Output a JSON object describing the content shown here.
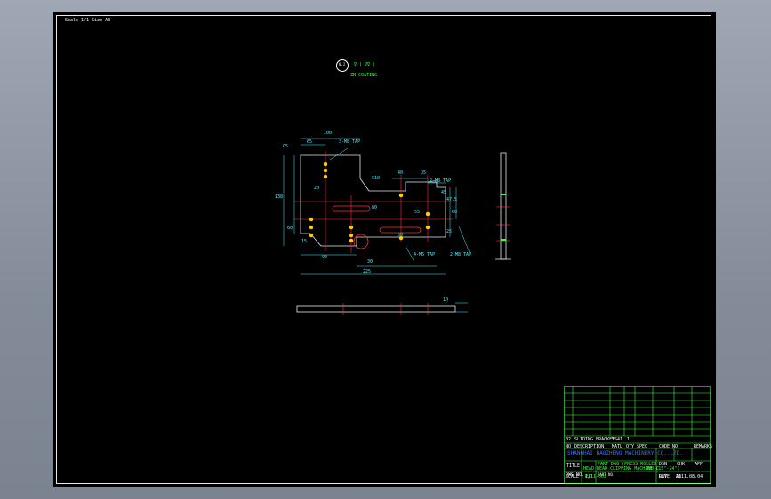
{
  "header": {
    "scale_note": "Scale 1/1  Size A3"
  },
  "surface_note": {
    "roughness": "0.2",
    "symbol": "∇ ( ∇∇ )",
    "coating": "ZN COATING"
  },
  "dimensions": {
    "top_100": "100",
    "top_65": "65",
    "chamfer": "C5",
    "left_138": "138",
    "left_60": "60",
    "r10": "C10",
    "d40": "40",
    "d35": "35",
    "d55": "55",
    "d20": "20",
    "d45": "45",
    "d90": "90",
    "d80": "80",
    "d50": "50",
    "d30": "30",
    "d225": "225",
    "d60r": "60",
    "d47": "47.5",
    "d25": "25",
    "d15": "15"
  },
  "callouts": {
    "tap_top": "3-M8 TAP",
    "tap_right": "2-M8 TAP",
    "tap_bottom": "4-M6 TAP",
    "tap_bottom2": "2-M8 TAP"
  },
  "side_view": {
    "dim": "10"
  },
  "title_block": {
    "row_item": {
      "no": "02",
      "desc": "SLIDING BRACKET",
      "qty": "SS41",
      "spec": "1"
    },
    "header_row": {
      "no": "NO",
      "desc": "DESCRIPTION",
      "matl": "MATL",
      "qty": "QTY",
      "spec": "SPEC",
      "code": "CODE NO.",
      "remarks": "REMARKS"
    },
    "company": "SHANGHAI BAOZHENG MACHINERY CO.,LTD.",
    "title_label": "TITLE",
    "title_line1": "PART DWG (PRESS ROLLER",
    "title_line2": "HEAD BEAD CLIPPING MACHINE (15\"-24\")",
    "title_code": "400 C",
    "dsn": "DSN",
    "chk": "CHK",
    "app": "APP",
    "scale_label": "SCALE",
    "scale_val": "1/1",
    "proj_label": "PART NO.",
    "date_label": "DATE",
    "date_val": "2011.08.04",
    "dwg_label": "DWG NO.",
    "dwg_val": "P111-002",
    "rev_label": "REV",
    "rev_val": "A1"
  }
}
